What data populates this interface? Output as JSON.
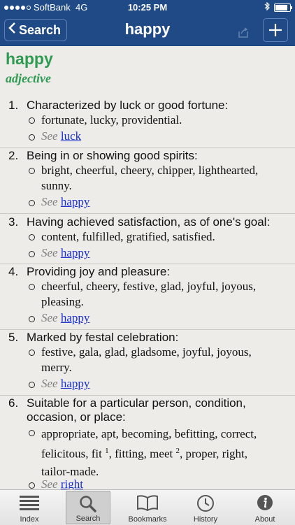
{
  "status_bar": {
    "carrier": "SoftBank",
    "network": "4G",
    "time": "10:25 PM",
    "battery_level": 0.95
  },
  "nav": {
    "back_label": "Search",
    "title": "happy"
  },
  "entry": {
    "headword": "happy",
    "part_of_speech": "adjective",
    "see_label": "See",
    "senses": [
      {
        "num": "1.",
        "definition": "Characterized by luck or good fortune:",
        "synonyms": "fortunate, lucky, providential.",
        "see_link": "luck"
      },
      {
        "num": "2.",
        "definition": "Being in or showing good spirits:",
        "synonyms_line1": "bright, cheerful, cheery, chipper, lighthearted,",
        "synonyms_line2": "sunny.",
        "see_link": "happy"
      },
      {
        "num": "3.",
        "definition": "Having achieved satisfaction, as of one's goal:",
        "synonyms": "content, fulfilled, gratified, satisfied.",
        "see_link": "happy"
      },
      {
        "num": "4.",
        "definition": "Providing joy and pleasure:",
        "synonyms_line1": "cheerful, cheery, festive, glad, joyful, joyous,",
        "synonyms_line2": "pleasing.",
        "see_link": "happy"
      },
      {
        "num": "5.",
        "definition": "Marked by festal celebration:",
        "synonyms_line1": "festive, gala, glad, gladsome, joyful, joyous,",
        "synonyms_line2": "merry.",
        "see_link": "happy"
      },
      {
        "num": "6.",
        "definition_line1": "Suitable for a particular person, condition,",
        "definition_line2": "occasion, or place:",
        "synonyms_line1": "appropriate, apt, becoming, befitting, correct,",
        "syn_fit": "felicitous, fit",
        "sup1": "1",
        "syn_meet": ", fitting, meet",
        "sup2": "2",
        "syn_rest": ", proper, right,",
        "synonyms_line3": "tailor-made.",
        "see_link": "right"
      }
    ]
  },
  "tabs": [
    {
      "label": "Index",
      "icon": "list-icon"
    },
    {
      "label": "Search",
      "icon": "magnifier-icon",
      "active": true
    },
    {
      "label": "Bookmarks",
      "icon": "book-icon"
    },
    {
      "label": "History",
      "icon": "clock-icon"
    },
    {
      "label": "About",
      "icon": "info-icon"
    }
  ]
}
